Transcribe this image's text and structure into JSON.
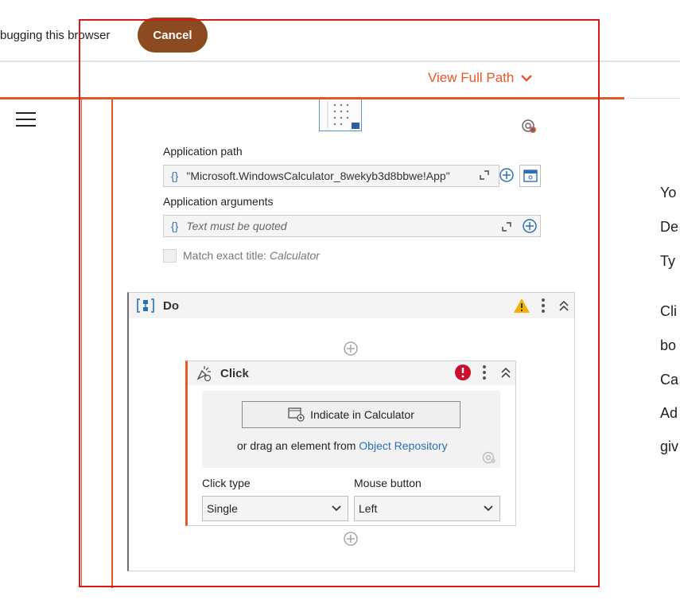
{
  "debug_bar": {
    "text": "bugging this browser",
    "cancel_label": "Cancel"
  },
  "breadcrumb": {
    "view_full_path": "View Full Path"
  },
  "form": {
    "app_path_label": "Application path",
    "app_path_value": "\"Microsoft.WindowsCalculator_8wekyb3d8bbwe!App\"",
    "app_args_label": "Application arguments",
    "app_args_placeholder": "Text must be quoted",
    "match_title_label": "Match exact title:",
    "match_title_value": "Calculator",
    "curly": "{}"
  },
  "do_block": {
    "title": "Do"
  },
  "click_activity": {
    "title": "Click",
    "indicate_label": "Indicate in Calculator",
    "drag_text": "or drag an element from",
    "drag_link": "Object Repository",
    "click_type_label": "Click type",
    "click_type_value": "Single",
    "mouse_button_label": "Mouse button",
    "mouse_button_value": "Left"
  },
  "side_text": [
    "Yo",
    "De",
    "Ty",
    "Cli",
    "bo",
    "Ca",
    "Ad",
    "giv"
  ],
  "colors": {
    "accent": "#e8562a",
    "cancel": "#8b4a1f",
    "selection": "#d61a1a",
    "link": "#2a6fb8",
    "warning": "#f2b300",
    "error": "#c8102e"
  },
  "icons": {
    "menu": "hamburger-icon",
    "chevron": "chevron-down-icon",
    "target": "target-icon",
    "expand": "expand-icon",
    "plus": "plus-circle-icon",
    "window": "window-icon",
    "do": "sequence-icon",
    "warning": "warning-icon",
    "error": "error-icon",
    "more": "more-vertical-icon",
    "collapse": "collapse-icon",
    "click": "click-icon"
  }
}
